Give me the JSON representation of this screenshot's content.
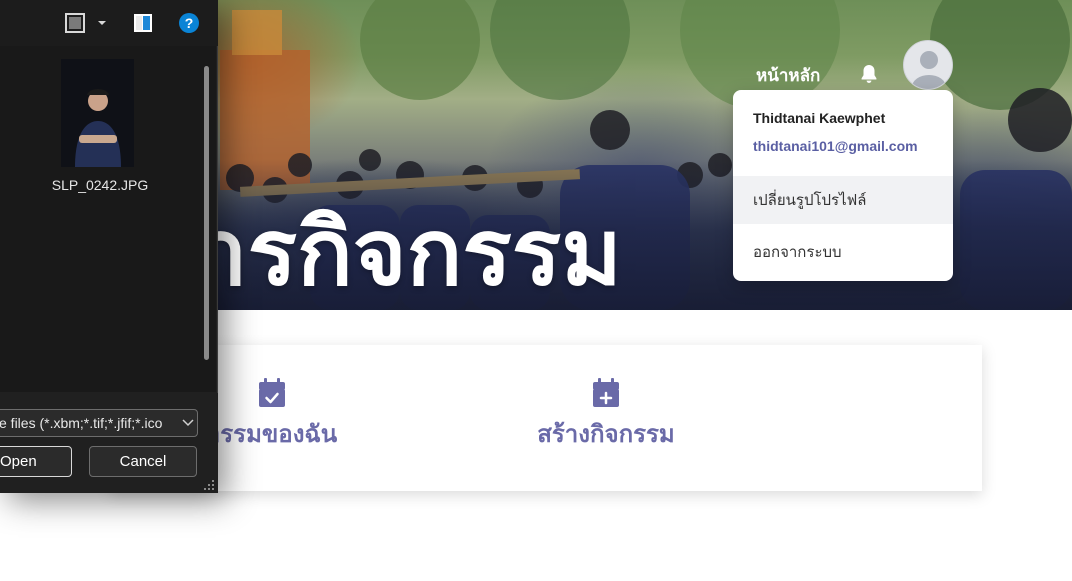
{
  "hero": {
    "title": "ารกิจกรรม"
  },
  "navbar": {
    "home_label": "หน้าหลัก",
    "bell_icon": "bell-icon",
    "avatar_icon": "user-avatar-icon"
  },
  "profile_menu": {
    "user_name": "Thidtanai Kaewphet",
    "email": "thidtanai101@gmail.com",
    "items": [
      {
        "label": "เปลี่ยนรูปโปรไฟล์"
      },
      {
        "label": "ออกจากระบบ"
      }
    ]
  },
  "menu_card": {
    "my_activities_label": "ารรมของฉัน",
    "create_activity_label": "สร้างกิจกรรม"
  },
  "file_dialog": {
    "files": [
      {
        "name": "SLP_0242.JPG"
      }
    ],
    "file_type_filter": "e files (*.xbm;*.tif;*.jfif;*.ico",
    "open_label": "Open",
    "cancel_label": "Cancel"
  },
  "colors": {
    "accent": "#6a6aa8",
    "email": "#5a5fa3",
    "dialog_bg": "#202020",
    "help_blue": "#0a84d6"
  }
}
